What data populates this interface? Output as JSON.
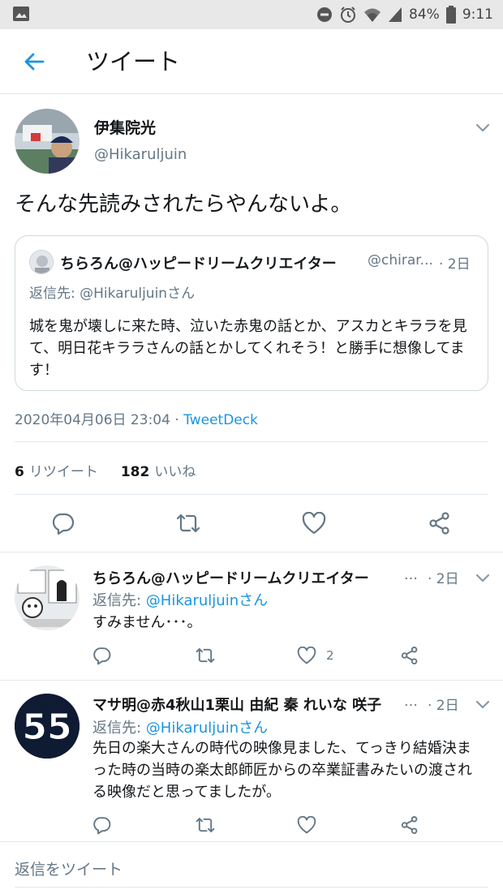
{
  "status_bar": {
    "battery": "84%",
    "time": "9:11"
  },
  "header": {
    "title": "ツイート"
  },
  "tweet": {
    "name": "伊集院光",
    "handle": "@Hikaruljuin",
    "text": "そんな先読みされたらやんないよ。",
    "quote": {
      "name": "ちらろん@ハッピードリームクリエイター",
      "handle": "@chirar...",
      "time": "· 2日",
      "reply_to": "返信先: @Hikaruljuinさん",
      "text": "城を鬼が壊しに来た時、泣いた赤鬼の話とか、アスカとキララを見て、明日花キララさんの話とかしてくれそう！と勝手に想像してます！"
    },
    "timestamp": "2020年04月06日 23:04 · ",
    "source": "TweetDeck",
    "retweets_count": "6",
    "retweets_label": "リツイート",
    "likes_count": "182",
    "likes_label": "いいね"
  },
  "replies": [
    {
      "name": "ちらろん@ハッピードリームクリエイター",
      "dots": "…",
      "time": "· 2日",
      "reply_prefix": "返信先: ",
      "reply_mention": "@Hikaruljuinさん",
      "text": "すみません･･･。",
      "likes": "2"
    },
    {
      "name": "マサ明@赤4秋山1栗山 由紀 秦 れいな 咲子",
      "dots": "…",
      "time": "· 2日",
      "reply_prefix": "返信先: ",
      "reply_mention": "@Hikaruljuinさん",
      "text": "先日の楽大さんの時代の映像見ました、てっきり結婚決まった時の当時の楽太郎師匠からの卒業証書みたいの渡される映像だと思ってましたが。",
      "avatar_text": "55"
    }
  ],
  "compose": {
    "placeholder": "返信をツイート"
  },
  "colors": {
    "accent": "#1b95e0",
    "text_primary": "#14171a",
    "text_secondary": "#657786",
    "divider": "#e1e8ed"
  },
  "icons": [
    "image-icon",
    "dnd-icon",
    "alarm-icon",
    "wifi-icon",
    "signal-icon",
    "battery-icon",
    "back-arrow-icon",
    "chevron-down-icon",
    "reply-icon",
    "retweet-icon",
    "like-icon",
    "share-icon"
  ]
}
